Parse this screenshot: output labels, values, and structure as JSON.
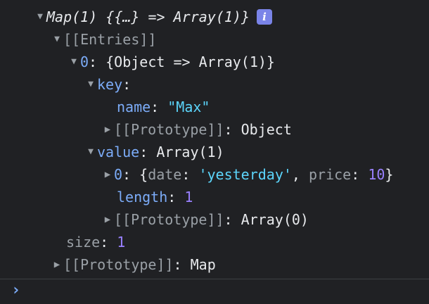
{
  "map_header": {
    "text": "Map(1) {{…} => Array(1)}",
    "info_badge": "i"
  },
  "entries_label": "[[Entries]]",
  "entry0": {
    "index": "0",
    "summary": "{Object => Array(1)}",
    "key": {
      "label": "key",
      "name_key": "name",
      "name_value": "\"Max\"",
      "proto_label": "[[Prototype]]",
      "proto_value": "Object"
    },
    "value": {
      "label": "value",
      "summary": "Array(1)",
      "item0_index": "0",
      "item0_open": "{",
      "item0_date_key": "date",
      "item0_date_value": "'yesterday'",
      "item0_price_key": "price",
      "item0_price_value": "10",
      "item0_close": "}",
      "length_key": "length",
      "length_value": "1",
      "proto_label": "[[Prototype]]",
      "proto_value": "Array(0)"
    }
  },
  "size_key": "size",
  "size_value": "1",
  "map_proto_label": "[[Prototype]]",
  "map_proto_value": "Map",
  "prompt_symbol": "›",
  "colors": {
    "background": "#202124",
    "text": "#e8eaed",
    "key_blue": "#7cacf8",
    "string": "#5cd5fb",
    "number": "#9980ff",
    "dim": "#9aa0a6",
    "badge": "#7a84e8"
  }
}
